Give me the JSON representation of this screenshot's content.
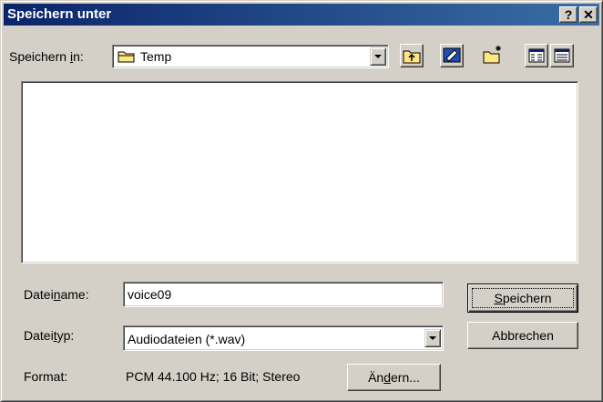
{
  "window": {
    "title": "Speichern unter",
    "help_glyph": "?",
    "close_glyph": "✕"
  },
  "save_in": {
    "label_pre": "Speichern ",
    "label_key": "i",
    "label_post": "n:",
    "value": "Temp"
  },
  "toolbar": {
    "icons": [
      "up-one-level-icon",
      "desktop-icon",
      "new-folder-icon",
      "list-view-icon",
      "details-view-icon"
    ]
  },
  "filename": {
    "label_pre": "Datei",
    "label_key": "n",
    "label_post": "ame:",
    "value": "voice09"
  },
  "filetype": {
    "label_pre": "Datei",
    "label_key": "t",
    "label_post": "yp:",
    "value": "Audiodateien (*.wav)"
  },
  "format": {
    "label": "Format:",
    "value": "PCM 44.100 Hz; 16 Bit; Stereo"
  },
  "buttons": {
    "save_key": "S",
    "save_rest": "peichern",
    "cancel": "Abbrechen",
    "change_pre": "Än",
    "change_key": "d",
    "change_post": "ern..."
  },
  "colors": {
    "title_start": "#0a246a",
    "title_end": "#3a6ea5",
    "face": "#d4d0c8",
    "folder": "#ffe680"
  }
}
